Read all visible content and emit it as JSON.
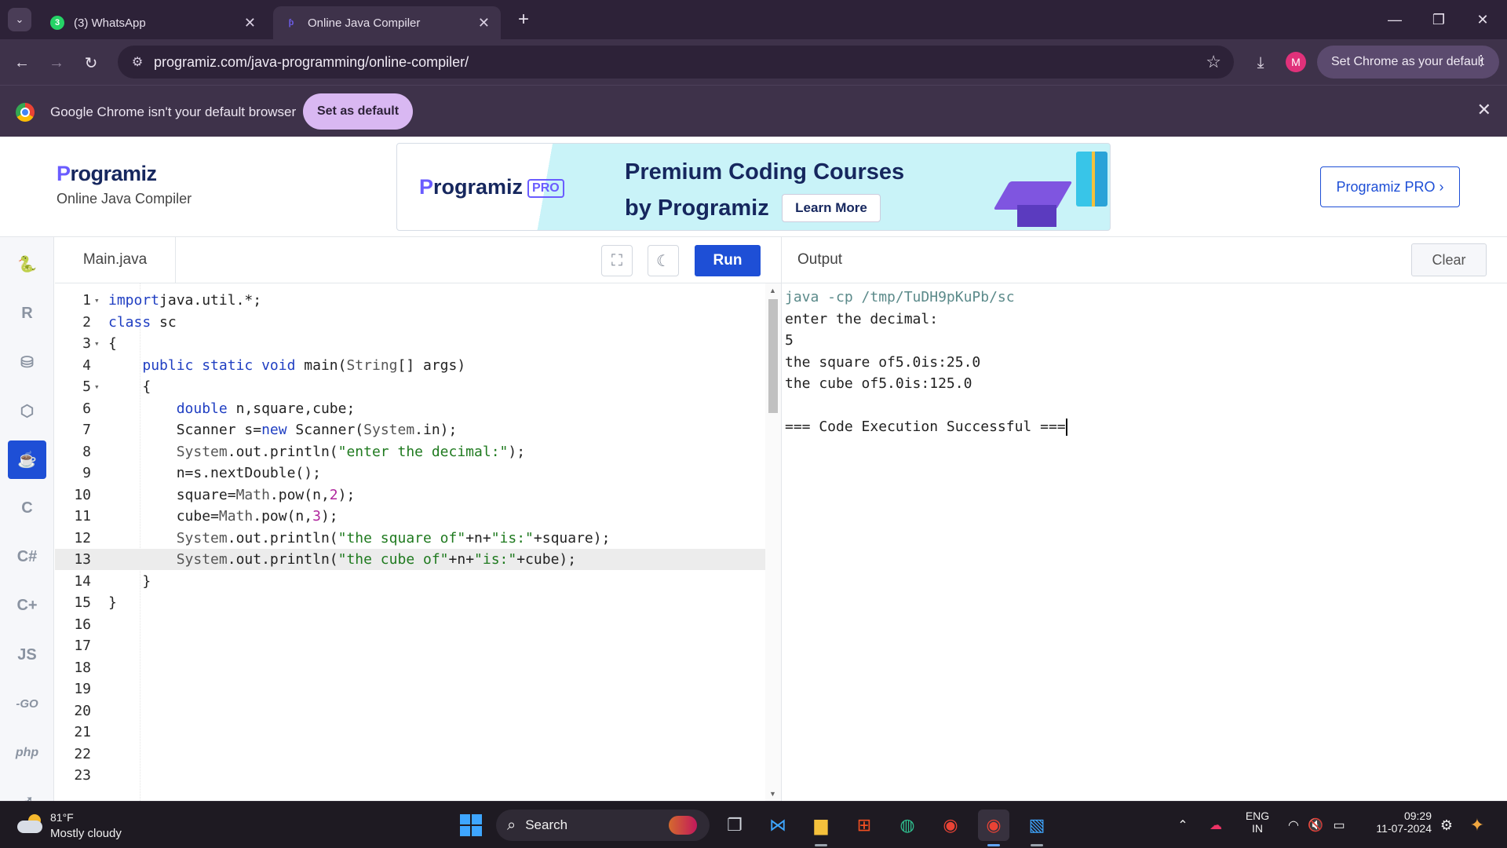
{
  "browser": {
    "tabs": [
      {
        "title": "(3) WhatsApp",
        "badge": "3"
      },
      {
        "title": "Online Java Compiler"
      }
    ],
    "url": "programiz.com/java-programming/online-compiler/",
    "profile_initial": "M",
    "set_chrome_default_label": "Set Chrome as your default",
    "infobar_text": "Google Chrome isn't your default browser",
    "infobar_button": "Set as default"
  },
  "site": {
    "logo_text": "rogramiz",
    "logo_mark": "P",
    "subtitle": "Online Java Compiler",
    "banner": {
      "logo_text": "rogramiz",
      "logo_mark": "P",
      "pro_badge": "PRO",
      "title_line1": "Premium Coding Courses",
      "title_line2": "by Programiz",
      "cta": "Learn More"
    },
    "pro_button": "Programiz PRO ›"
  },
  "rail": {
    "languages": [
      "python",
      "r",
      "sql",
      "html",
      "java",
      "c",
      "csharp",
      "cpp",
      "js",
      "go",
      "php",
      "swift"
    ],
    "active": "java",
    "labels": {
      "js": "JS",
      "go": "-GO",
      "php": "php",
      "r": "R",
      "c": "C"
    }
  },
  "editor": {
    "filename": "Main.java",
    "run_label": "Run",
    "active_line": 13,
    "lines": [
      {
        "n": "1",
        "fold": true,
        "tokens": [
          [
            "kw",
            "import"
          ],
          [
            "",
            "java.util.*;"
          ]
        ]
      },
      {
        "n": "2",
        "fold": false,
        "tokens": [
          [
            "kw",
            "class"
          ],
          [
            "",
            " sc"
          ]
        ]
      },
      {
        "n": "3",
        "fold": true,
        "tokens": [
          [
            "",
            "{"
          ]
        ]
      },
      {
        "n": "4",
        "fold": false,
        "tokens": [
          [
            "",
            "    "
          ],
          [
            "kw",
            "public static void"
          ],
          [
            "",
            " main("
          ],
          [
            "cls",
            "String"
          ],
          [
            "",
            "[] args)"
          ]
        ]
      },
      {
        "n": "5",
        "fold": true,
        "tokens": [
          [
            "",
            "    {"
          ]
        ]
      },
      {
        "n": "6",
        "fold": false,
        "tokens": [
          [
            "",
            "        "
          ],
          [
            "kw",
            "double"
          ],
          [
            "",
            " n,square,cube;"
          ]
        ]
      },
      {
        "n": "7",
        "fold": false,
        "tokens": [
          [
            "",
            "        Scanner s="
          ],
          [
            "kw",
            "new"
          ],
          [
            "",
            " Scanner("
          ],
          [
            "cls",
            "System"
          ],
          [
            "",
            ".in);"
          ]
        ]
      },
      {
        "n": "8",
        "fold": false,
        "tokens": [
          [
            "",
            "        "
          ],
          [
            "cls",
            "System"
          ],
          [
            "",
            ".out.println("
          ],
          [
            "str",
            "\"enter the decimal:\""
          ],
          [
            "",
            ");"
          ]
        ]
      },
      {
        "n": "9",
        "fold": false,
        "tokens": [
          [
            "",
            "        n=s.nextDouble();"
          ]
        ]
      },
      {
        "n": "10",
        "fold": false,
        "tokens": [
          [
            "",
            "        square="
          ],
          [
            "cls",
            "Math"
          ],
          [
            "",
            ".pow(n,"
          ],
          [
            "num",
            "2"
          ],
          [
            "",
            ");"
          ]
        ]
      },
      {
        "n": "11",
        "fold": false,
        "tokens": [
          [
            "",
            "        cube="
          ],
          [
            "cls",
            "Math"
          ],
          [
            "",
            ".pow(n,"
          ],
          [
            "num",
            "3"
          ],
          [
            "",
            ");"
          ]
        ]
      },
      {
        "n": "12",
        "fold": false,
        "tokens": [
          [
            "",
            "        "
          ],
          [
            "cls",
            "System"
          ],
          [
            "",
            ".out.println("
          ],
          [
            "str",
            "\"the square of\""
          ],
          [
            "",
            "+n+"
          ],
          [
            "str",
            "\"is:\""
          ],
          [
            "",
            "+square);"
          ]
        ]
      },
      {
        "n": "13",
        "fold": false,
        "tokens": [
          [
            "",
            "        "
          ],
          [
            "cls",
            "System"
          ],
          [
            "",
            ".out.println("
          ],
          [
            "str",
            "\"the cube of\""
          ],
          [
            "",
            "+n+"
          ],
          [
            "str",
            "\"is:\""
          ],
          [
            "",
            "+cube);"
          ]
        ]
      },
      {
        "n": "14",
        "fold": false,
        "tokens": [
          [
            "",
            "    }"
          ]
        ]
      },
      {
        "n": "15",
        "fold": false,
        "tokens": [
          [
            "",
            "}"
          ]
        ]
      },
      {
        "n": "16",
        "fold": false,
        "tokens": []
      },
      {
        "n": "17",
        "fold": false,
        "tokens": []
      },
      {
        "n": "18",
        "fold": false,
        "tokens": []
      },
      {
        "n": "19",
        "fold": false,
        "tokens": []
      },
      {
        "n": "20",
        "fold": false,
        "tokens": []
      },
      {
        "n": "21",
        "fold": false,
        "tokens": []
      },
      {
        "n": "22",
        "fold": false,
        "tokens": []
      },
      {
        "n": "23",
        "fold": false,
        "tokens": []
      }
    ]
  },
  "output": {
    "title": "Output",
    "clear_label": "Clear",
    "lines": [
      {
        "text": "java -cp /tmp/TuDH9pKuPb/sc",
        "cmd": true
      },
      {
        "text": "enter the decimal:"
      },
      {
        "text": "5"
      },
      {
        "text": "the square of5.0is:25.0"
      },
      {
        "text": "the cube of5.0is:125.0"
      },
      {
        "text": ""
      },
      {
        "text": "=== Code Execution Successful ===",
        "cursor": true
      }
    ]
  },
  "taskbar": {
    "weather_temp": "81°F",
    "weather_desc": "Mostly cloudy",
    "search_label": "Search",
    "lang_line1": "ENG",
    "lang_line2": "IN",
    "time": "09:29",
    "date": "11-07-2024",
    "apps": [
      "start",
      "search",
      "task-view",
      "vscode",
      "file-explorer",
      "ms-store",
      "edge",
      "chrome",
      "chrome-profile",
      "paint"
    ]
  }
}
